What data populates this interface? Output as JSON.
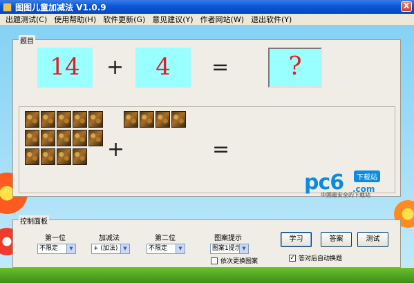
{
  "window": {
    "title": "图图儿童加减法 V1.0.9",
    "close_label": "X"
  },
  "menu": [
    {
      "label": "出题测试(C)"
    },
    {
      "label": "使用帮助(H)"
    },
    {
      "label": "软件更新(G)"
    },
    {
      "label": "意见建议(Y)"
    },
    {
      "label": "作者网站(W)"
    },
    {
      "label": "退出软件(Y)"
    }
  ],
  "question_panel": {
    "legend": "题目",
    "first_number": "14",
    "operator": "+",
    "second_number": "4",
    "equals": "=",
    "answer": "?",
    "picture_operator": "+",
    "picture_equals": "=",
    "first_picture_count": 14,
    "second_picture_count": 4,
    "picture_icon": "leopard-picture-icon"
  },
  "control_panel": {
    "legend": "控制面板",
    "first_digit": {
      "label": "第一位",
      "value": "不限定"
    },
    "operation": {
      "label": "加减法",
      "value": "+ (加法)"
    },
    "second_digit": {
      "label": "第二位",
      "value": "不限定"
    },
    "picture_hint": {
      "label": "图案提示",
      "value": "图案1提示"
    },
    "change_picture_checkbox": {
      "label": "依次更换图案",
      "checked": false
    },
    "auto_switch_checkbox": {
      "label": "答对后自动换题",
      "checked": true
    },
    "buttons": {
      "learn": "学习",
      "answer": "答案",
      "test": "测试"
    }
  },
  "watermark": {
    "main": "pc6",
    "tag": "下载站",
    "sub": ".com",
    "bottom": "中国最安全的下载站"
  },
  "colors": {
    "number_card_bg": "#99ffff",
    "number_color": "#e51c23",
    "titlebar": "#0a58d6"
  }
}
